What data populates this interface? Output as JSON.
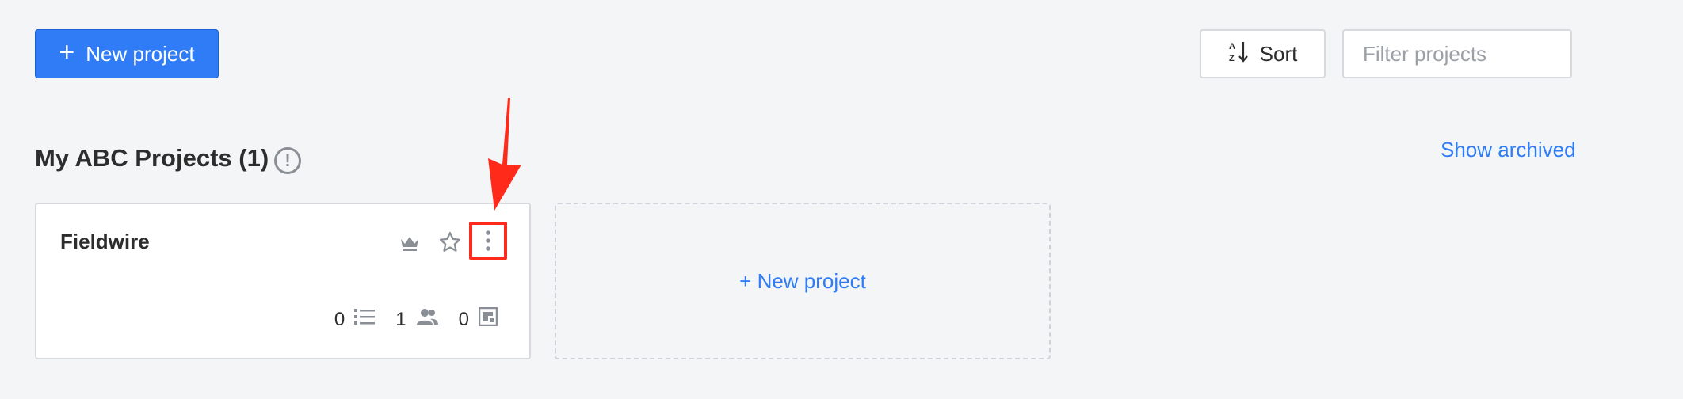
{
  "toolbar": {
    "new_project_label": "New project",
    "sort_label": "Sort",
    "filter_placeholder": "Filter projects"
  },
  "section": {
    "title": "My ABC Projects (1)",
    "info_glyph": "!",
    "show_archived_label": "Show archived"
  },
  "projects": [
    {
      "name": "Fieldwire",
      "tasks_count": "0",
      "people_count": "1",
      "plans_count": "0"
    }
  ],
  "new_project_card_label": "+ New project",
  "colors": {
    "accent": "#2f7cf6",
    "highlight": "#ff2a1a",
    "background": "#f4f5f7"
  },
  "icons": [
    "plus-icon",
    "sort-alpha-icon",
    "info-icon",
    "crown-icon",
    "star-icon",
    "more-vertical-icon",
    "list-icon",
    "people-icon",
    "plans-icon",
    "annotation-arrow"
  ]
}
